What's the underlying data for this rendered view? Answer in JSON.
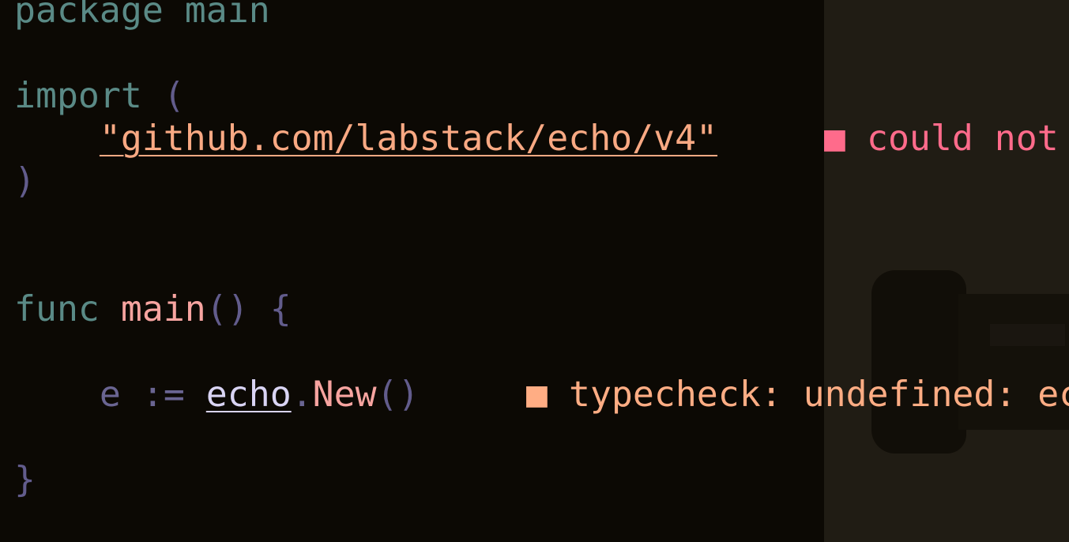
{
  "editor": {
    "lines": {
      "l1": {
        "keyword": "package",
        "name": "main"
      },
      "l3": {
        "keyword": "import",
        "open": "("
      },
      "l4": {
        "string": "\"github.com/labstack/echo/v4\"",
        "diagnostic_marker": "■",
        "diagnostic": "could not"
      },
      "l5": {
        "close": ")"
      },
      "l8": {
        "keyword": "func",
        "name": "main",
        "parens": "()",
        "brace": "{"
      },
      "l10": {
        "var": "e",
        "op": ":=",
        "pkg": "echo",
        "dot": ".",
        "call": "New",
        "parens": "()",
        "diagnostic_marker": "■",
        "diagnostic": "typecheck: undefined: ec"
      },
      "l12": {
        "close": "}"
      }
    }
  },
  "colors": {
    "background": "#0c0904",
    "side_panel": "#201c14",
    "keyword": "#5a8a86",
    "punctuation": "#625c8c",
    "string": "#f9a983",
    "function": "#f7a4a0",
    "error": "#ff6b8b",
    "warning": "#ffad84"
  }
}
